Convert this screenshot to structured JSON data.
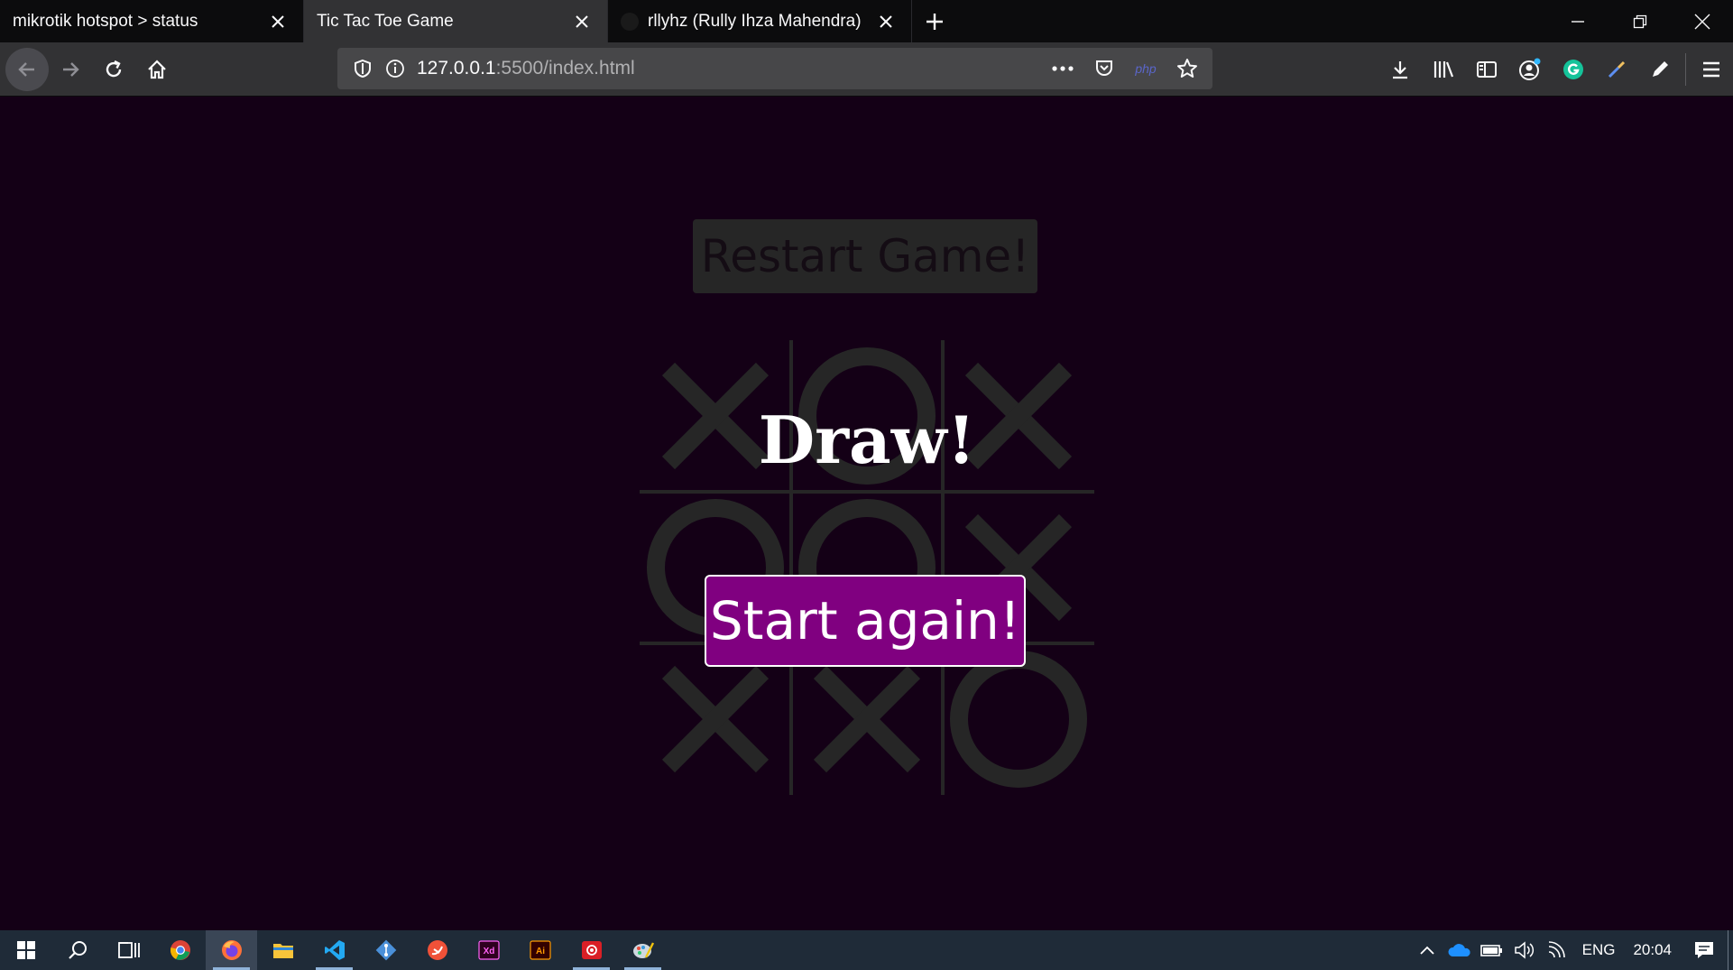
{
  "browser": {
    "tabs": [
      {
        "title": "mikrotik hotspot > status",
        "active": false
      },
      {
        "title": "Tic Tac Toe Game",
        "active": true
      },
      {
        "title": "rllyhz (Rully Ihza Mahendra)",
        "active": false
      }
    ],
    "url": {
      "host": "127.0.0.1",
      "rest": ":5500/index.html"
    },
    "php_badge": "php"
  },
  "game": {
    "restart_label": "Restart Game!",
    "board": [
      "X",
      "O",
      "X",
      "O",
      "O",
      "X",
      "X",
      "X",
      "O"
    ],
    "result_message": "Draw!",
    "start_again_label": "Start again!",
    "colors": {
      "background": "#140016",
      "marks": "#262626",
      "accent": "#800080"
    }
  },
  "taskbar": {
    "apps": [
      "start",
      "search",
      "task-view",
      "chrome",
      "firefox",
      "file-explorer",
      "vscode",
      "git",
      "swift",
      "adobe-xd",
      "adobe-illustrator",
      "creative-cloud",
      "paint"
    ],
    "language": "ENG",
    "clock": "20:04"
  }
}
